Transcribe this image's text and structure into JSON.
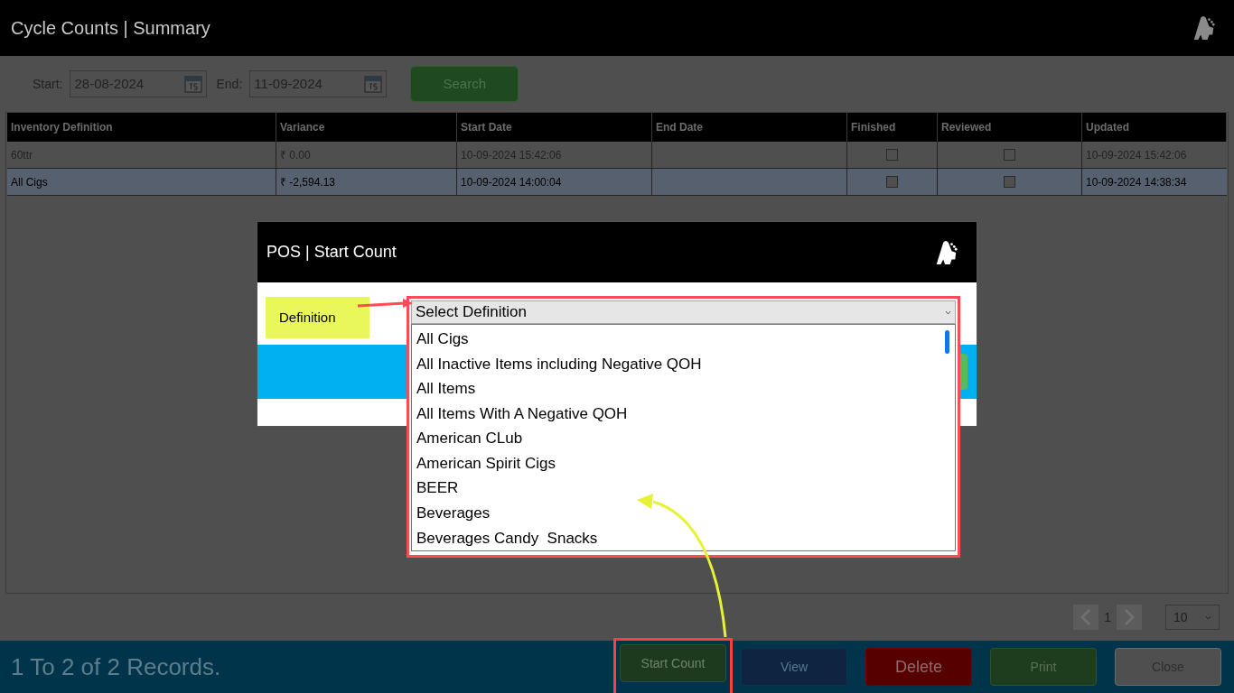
{
  "window": {
    "title": "Cycle Counts | Summary"
  },
  "filters": {
    "start_label": "Start:",
    "start_value": "28-08-2024",
    "end_label": "End:",
    "end_value": "11-09-2024",
    "search_button": "Search"
  },
  "table": {
    "columns": [
      "Inventory Definition",
      "Variance",
      "Start Date",
      "End Date",
      "Finished",
      "Reviewed",
      "Updated"
    ],
    "rows": [
      {
        "definition": "60ttr",
        "variance": "₹ 0.00",
        "start_date": "10-09-2024 15:42:06",
        "finished": false,
        "reviewed": false,
        "updated": "10-09-2024 15:42:06",
        "selected": false
      },
      {
        "definition": "All Cigs",
        "variance": "₹ -2,594.13",
        "start_date": "10-09-2024 14:00:04",
        "finished": false,
        "reviewed": false,
        "updated": "10-09-2024 14:38:34",
        "selected": true
      }
    ]
  },
  "pagination": {
    "page": "1",
    "page_size": "10"
  },
  "status_bar": {
    "records": "1 To 2 of 2 Records.",
    "buttons": [
      {
        "label": "Start Count",
        "kind": "start",
        "highlighted": true
      },
      {
        "label": "View",
        "kind": "view",
        "highlighted": false
      },
      {
        "label": "Delete",
        "kind": "delete",
        "highlighted": false
      },
      {
        "label": "Print",
        "kind": "print",
        "highlighted": false
      },
      {
        "label": "Close",
        "kind": "close",
        "highlighted": false
      }
    ]
  },
  "dialog": {
    "title": "POS | Start Count",
    "definition_label": "Definition",
    "select": {
      "placeholder": "Select Definition",
      "expanded": true,
      "highlighted": true,
      "options": [
        "All Cigs",
        "All Inactive Items including Negative QOH",
        "All Items",
        "All Items With A Negative QOH",
        "American CLub",
        "American Spirit Cigs",
        "BEER",
        "Beverages",
        "Beverages Candy  Snacks"
      ]
    }
  }
}
